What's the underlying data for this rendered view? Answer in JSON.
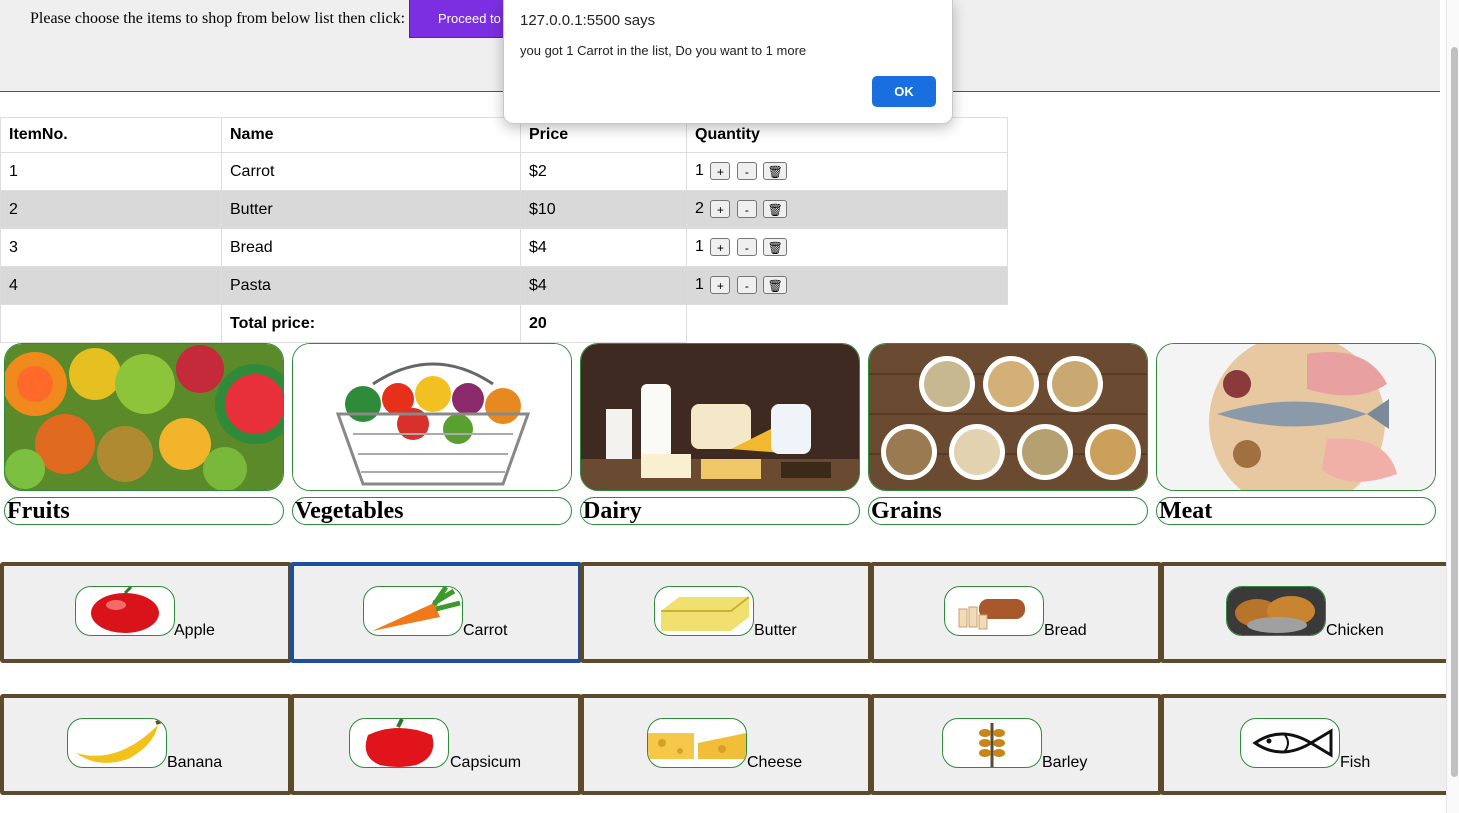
{
  "header": {
    "instruction": "Please choose the items to shop from below list then click:",
    "proceed_label": "Proceed to"
  },
  "cart": {
    "columns": [
      "ItemNo.",
      "Name",
      "Price",
      "Quantity"
    ],
    "rows": [
      {
        "no": "1",
        "name": "Carrot",
        "price": "$2",
        "qty": "1"
      },
      {
        "no": "2",
        "name": "Butter",
        "price": "$10",
        "qty": "2"
      },
      {
        "no": "3",
        "name": "Bread",
        "price": "$4",
        "qty": "1"
      },
      {
        "no": "4",
        "name": "Pasta",
        "price": "$4",
        "qty": "1"
      }
    ],
    "plus": "+",
    "minus": "-",
    "delete_icon": "🗑",
    "total_label": "Total price:",
    "total_value": "20"
  },
  "categories": [
    {
      "label": "Fruits",
      "icon": "fruits-photo"
    },
    {
      "label": "Vegetables",
      "icon": "vegetables-basket-photo"
    },
    {
      "label": "Dairy",
      "icon": "dairy-photo"
    },
    {
      "label": "Grains",
      "icon": "grains-photo"
    },
    {
      "label": "Meat",
      "icon": "meat-fish-photo"
    }
  ],
  "items": [
    {
      "label": "Apple",
      "icon": "apple"
    },
    {
      "label": "Carrot",
      "icon": "carrot"
    },
    {
      "label": "Butter",
      "icon": "butter"
    },
    {
      "label": "Bread",
      "icon": "bread"
    },
    {
      "label": "Chicken",
      "icon": "chicken"
    },
    {
      "label": "Banana",
      "icon": "banana"
    },
    {
      "label": "Capsicum",
      "icon": "capsicum"
    },
    {
      "label": "Cheese",
      "icon": "cheese"
    },
    {
      "label": "Barley",
      "icon": "barley"
    },
    {
      "label": "Fish",
      "icon": "fish"
    }
  ],
  "dialog": {
    "title": "127.0.0.1:5500 says",
    "message": "you got 1 Carrot in the list, Do you want to 1 more",
    "ok_label": "OK"
  },
  "colors": {
    "accent": "#7b2fe0",
    "ok": "#1a6fe0",
    "card_border": "#5c4a2a",
    "selected_border": "#1d4f9c",
    "thumb_border": "#2e8b3a"
  }
}
